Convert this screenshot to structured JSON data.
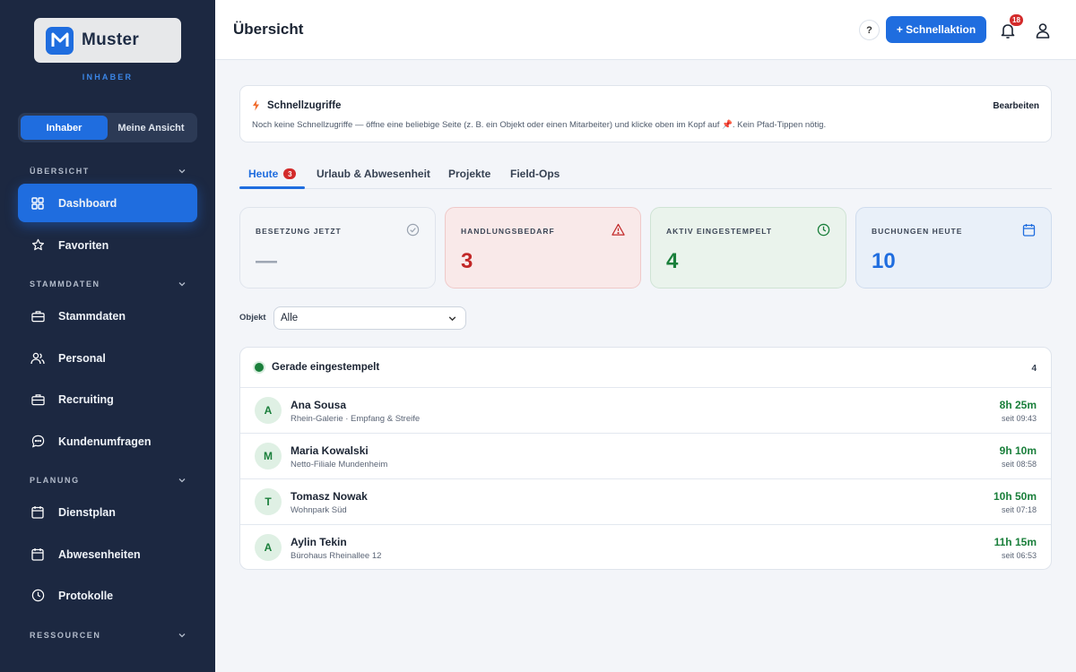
{
  "sidebar": {
    "brand": "Muster",
    "role": "INHABER",
    "toggle": [
      "Inhaber",
      "Meine Ansicht"
    ],
    "sections": [
      {
        "title": "ÜBERSICHT",
        "items": [
          "Dashboard",
          "Favoriten"
        ]
      },
      {
        "title": "STAMMDATEN",
        "items": [
          "Stammdaten",
          "Personal",
          "Recruiting",
          "Kundenumfragen"
        ]
      },
      {
        "title": "PLANUNG",
        "items": [
          "Dienstplan",
          "Abwesenheiten",
          "Protokolle"
        ]
      },
      {
        "title": "RESSOURCEN",
        "items": []
      }
    ],
    "icons": [
      "grid-icon",
      "star-icon",
      "briefcase-icon",
      "people-icon",
      "briefcase-icon",
      "chat-bubble-icon",
      "calendar-icon",
      "calendar-icon",
      "clock-icon"
    ]
  },
  "header": {
    "title": "Übersicht",
    "help": "?",
    "quick_action": "+ Schnellaktion",
    "notifications": "18"
  },
  "quick_access": {
    "title": "Schnellzugriffe",
    "edit": "Bearbeiten",
    "text_before": "Noch keine Schnellzugriffe — öffne eine beliebige Seite (z. B. ein Objekt oder einen Mitarbeiter) und klicke oben im Kopf auf",
    "pin": "📌",
    "text_after": ". Kein Pfad-Tippen nötig."
  },
  "tabs": [
    {
      "label": "Heute",
      "count": "3"
    },
    {
      "label": "Urlaub & Abwesenheit"
    },
    {
      "label": "Projekte"
    },
    {
      "label": "Field-Ops"
    }
  ],
  "kpis": [
    {
      "label": "BESETZUNG JETZT",
      "value": "—",
      "icon": "check-circle-icon",
      "bg": "#f4f6f9",
      "border": "#dfe4ec",
      "color": "#9aa3b0"
    },
    {
      "label": "HANDLUNGSBEDARF",
      "value": "3",
      "icon": "warning-icon",
      "bg": "#f9e9e9",
      "border": "#efc9c9",
      "color": "#c22727"
    },
    {
      "label": "AKTIV EINGESTEMPELT",
      "value": "4",
      "icon": "clock-icon",
      "bg": "#eaf3ec",
      "border": "#cfe3d4",
      "color": "#1a7f3b"
    },
    {
      "label": "BUCHUNGEN HEUTE",
      "value": "10",
      "icon": "calendar-icon",
      "bg": "#e9f0f9",
      "border": "#cfdcee",
      "color": "#1f6ddf"
    }
  ],
  "filter": {
    "label": "Objekt",
    "value": "Alle"
  },
  "clocked_in": {
    "title": "Gerade eingestempelt",
    "count": "4",
    "rows": [
      {
        "initial": "A",
        "name": "Ana Sousa",
        "location": "Rhein-Galerie · Empfang & Streife",
        "duration": "8h 25m",
        "since": "seit 09:43"
      },
      {
        "initial": "M",
        "name": "Maria Kowalski",
        "location": "Netto-Filiale Mundenheim",
        "duration": "9h 10m",
        "since": "seit 08:58"
      },
      {
        "initial": "T",
        "name": "Tomasz Nowak",
        "location": "Wohnpark Süd",
        "duration": "10h 50m",
        "since": "seit 07:18"
      },
      {
        "initial": "A",
        "name": "Aylin Tekin",
        "location": "Bürohaus Rheinallee 12",
        "duration": "11h 15m",
        "since": "seit 06:53"
      }
    ]
  }
}
